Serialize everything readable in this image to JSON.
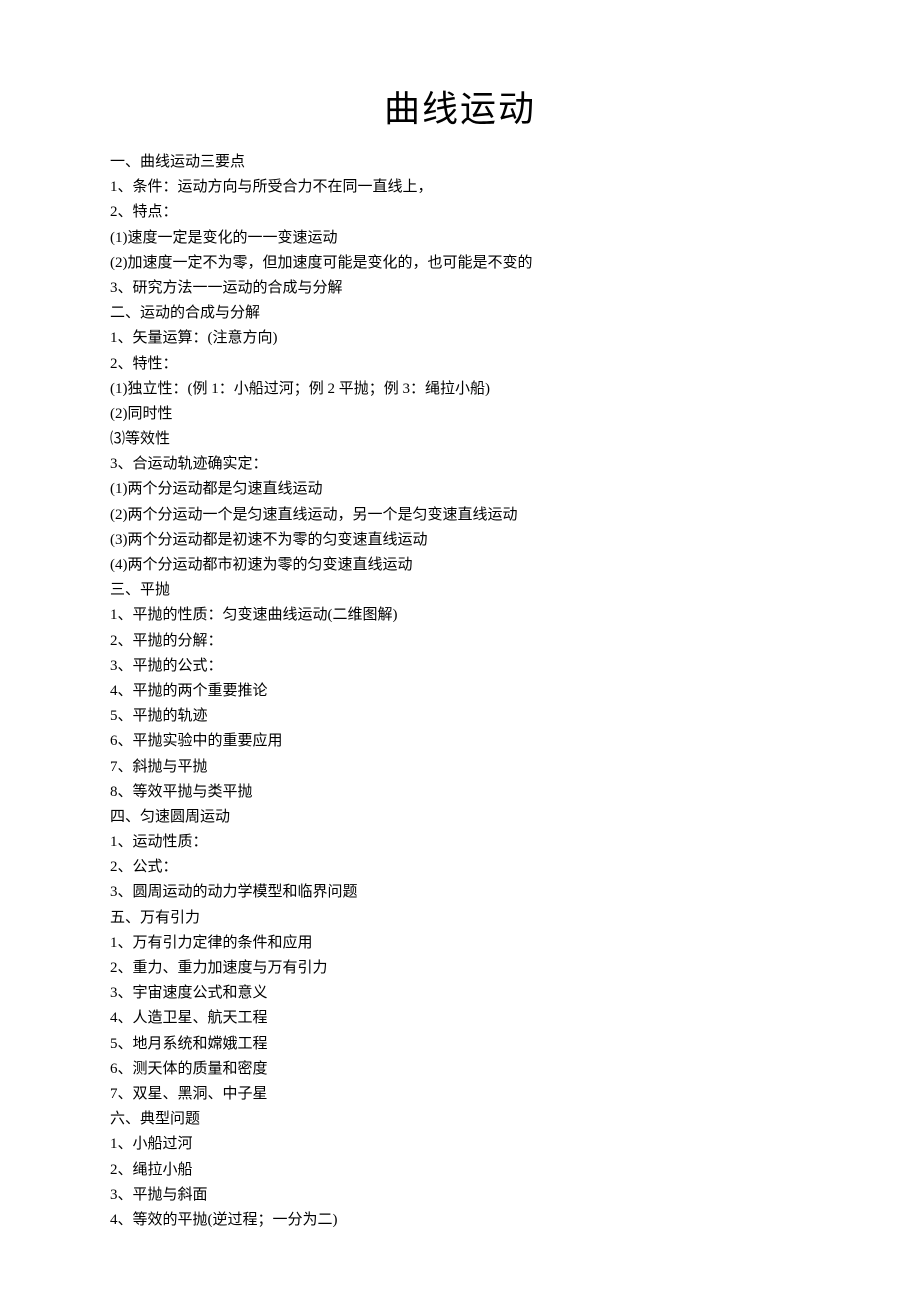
{
  "title": "曲线运动",
  "lines": [
    "一、曲线运动三要点",
    "1、条件：运动方向与所受合力不在同一直线上，",
    "2、特点：",
    "(1)速度一定是变化的一一变速运动",
    "(2)加速度一定不为零，但加速度可能是变化的，也可能是不变的",
    "3、研究方法一一运动的合成与分解",
    "二、运动的合成与分解",
    "1、矢量运算：(注意方向)",
    "2、特性：",
    "(1)独立性：(例 1：小船过河；例 2 平抛；例 3：绳拉小船)",
    "(2)同时性",
    "⑶等效性",
    "3、合运动轨迹确实定：",
    "(1)两个分运动都是匀速直线运动",
    "(2)两个分运动一个是匀速直线运动，另一个是匀变速直线运动",
    "(3)两个分运动都是初速不为零的匀变速直线运动",
    "(4)两个分运动都市初速为零的匀变速直线运动",
    "三、平抛",
    "1、平抛的性质：匀变速曲线运动(二维图解)",
    "2、平抛的分解：",
    "3、平抛的公式：",
    "4、平抛的两个重要推论",
    "5、平抛的轨迹",
    "6、平抛实验中的重要应用",
    "7、斜抛与平抛",
    "8、等效平抛与类平抛",
    "四、匀速圆周运动",
    "1、运动性质：",
    "2、公式：",
    "3、圆周运动的动力学模型和临界问题",
    "五、万有引力",
    "1、万有引力定律的条件和应用",
    "2、重力、重力加速度与万有引力",
    "3、宇宙速度公式和意义",
    "4、人造卫星、航天工程",
    "5、地月系统和嫦娥工程",
    "6、测天体的质量和密度",
    "7、双星、黑洞、中子星",
    "六、典型问题",
    "1、小船过河",
    "2、绳拉小船",
    "3、平抛与斜面",
    "4、等效的平抛(逆过程；一分为二)"
  ]
}
